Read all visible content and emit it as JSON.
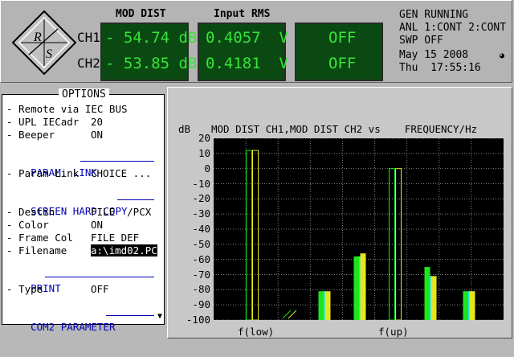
{
  "status": {
    "col_mod_dist": "MOD DIST",
    "col_input_rms": "Input RMS",
    "ch1_label": "CH1",
    "ch2_label": "CH2",
    "ch1_dist": "- 54.74 dB",
    "ch2_dist": "- 53.85 dB",
    "ch1_rms": "0.4057  V",
    "ch2_rms": "0.4181  V",
    "ch1_third": "OFF",
    "ch2_third": "OFF",
    "gen": "GEN RUNNING",
    "anl": "ANL 1:CONT 2:CONT",
    "swp": "SWP OFF",
    "date": "May 15 2008",
    "time": "Thu  17:55:16",
    "logo_text": "R&S"
  },
  "options": {
    "title": "OPTIONS",
    "rows1": [
      {
        "label": "- Remote via IEC BUS",
        "value": ""
      },
      {
        "label": "- UPL IECadr",
        "value": "20"
      },
      {
        "label": "- Beeper",
        "value": "ON"
      }
    ],
    "sec_param": "PARAM. LINK",
    "param_label": "- Param Link",
    "param_value": "CHOICE ...",
    "sec_hardcopy": "SCREEN HARD COPY",
    "destin_label": "- Destin",
    "destin_value": "FILE  /PCX",
    "color_label": "- Color",
    "color_value": "ON",
    "framecol_label": "- Frame Col",
    "framecol_value": "FILE DEF",
    "filename_label": "- Filename",
    "filename_value": "a:\\imd02.PC",
    "sec_print": "PRINT",
    "type_label": "- Type",
    "type_value": "OFF",
    "sec_com2": "COM2 PARAMETER"
  },
  "chart_data": {
    "type": "bar",
    "title": "MOD DIST CH1,MOD DIST CH2 vs    FREQUENCY/Hz",
    "ylabel": "dB",
    "ylim": [
      -100,
      20
    ],
    "yticks": [
      20,
      10,
      0,
      -10,
      -20,
      -30,
      -40,
      -50,
      -60,
      -70,
      -80,
      -90,
      -100
    ],
    "xticks": [
      "f(low)",
      "f(up)"
    ],
    "grid": true,
    "series": [
      {
        "color": "#1ee61e",
        "values": [
          12,
          -100,
          -81,
          -58,
          0,
          -65,
          -81
        ]
      },
      {
        "color": "#e6e61e",
        "values": [
          12,
          -100,
          -81,
          -56,
          0,
          -71,
          -81
        ]
      }
    ],
    "colors": {
      "ch1": "#1ee61e",
      "ch2": "#e6e61e",
      "fill": "#18e6e6"
    }
  }
}
